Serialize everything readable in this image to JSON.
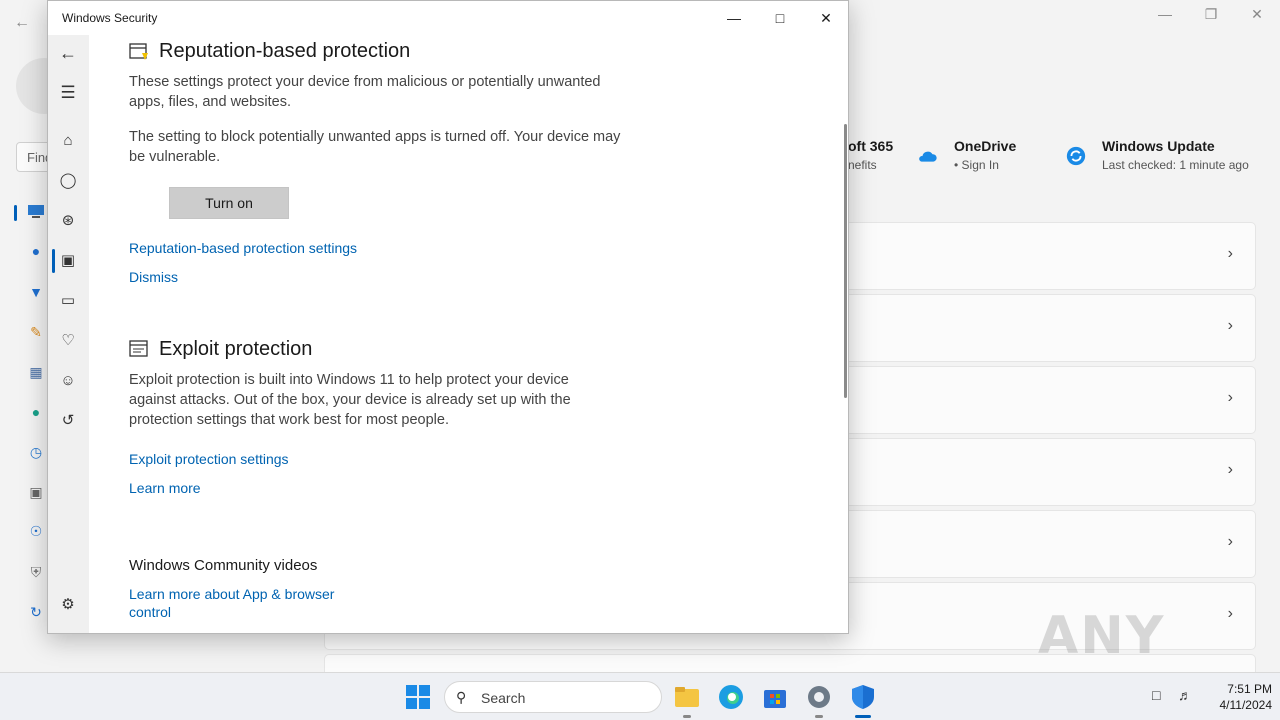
{
  "settings_bg": {
    "search_placeholder": "Find",
    "tiles": [
      {
        "title": "oft 365",
        "subtitle": "nefits"
      },
      {
        "title": "OneDrive",
        "subtitle": "•  Sign In"
      },
      {
        "title": "Windows Update",
        "subtitle": "Last checked: 1 minute ago"
      }
    ]
  },
  "security_window": {
    "title": "Windows Security",
    "reputation": {
      "heading": "Reputation-based protection",
      "description": "These settings protect your device from malicious or potentially unwanted apps, files, and websites.",
      "warning": "The setting to block potentially unwanted apps is turned off. Your device may be vulnerable.",
      "turn_on_label": "Turn on",
      "settings_link": "Reputation-based protection settings",
      "dismiss_link": "Dismiss"
    },
    "exploit": {
      "heading": "Exploit protection",
      "description": "Exploit protection is built into Windows 11 to help protect your device against attacks.  Out of the box, your device is already set up with the protection settings that work best for most people.",
      "settings_link": "Exploit protection settings",
      "learn_more_link": "Learn more"
    },
    "community": {
      "heading": "Windows Community videos",
      "link": "Learn more about App & browser control"
    }
  },
  "taskbar": {
    "search_label": "Search",
    "time": "7:51 PM",
    "date": "4/11/2024"
  },
  "watermark": "ANY RUN",
  "colors": {
    "accent": "#005fb8",
    "link": "#0063b1",
    "button_bg": "#cccccc"
  }
}
